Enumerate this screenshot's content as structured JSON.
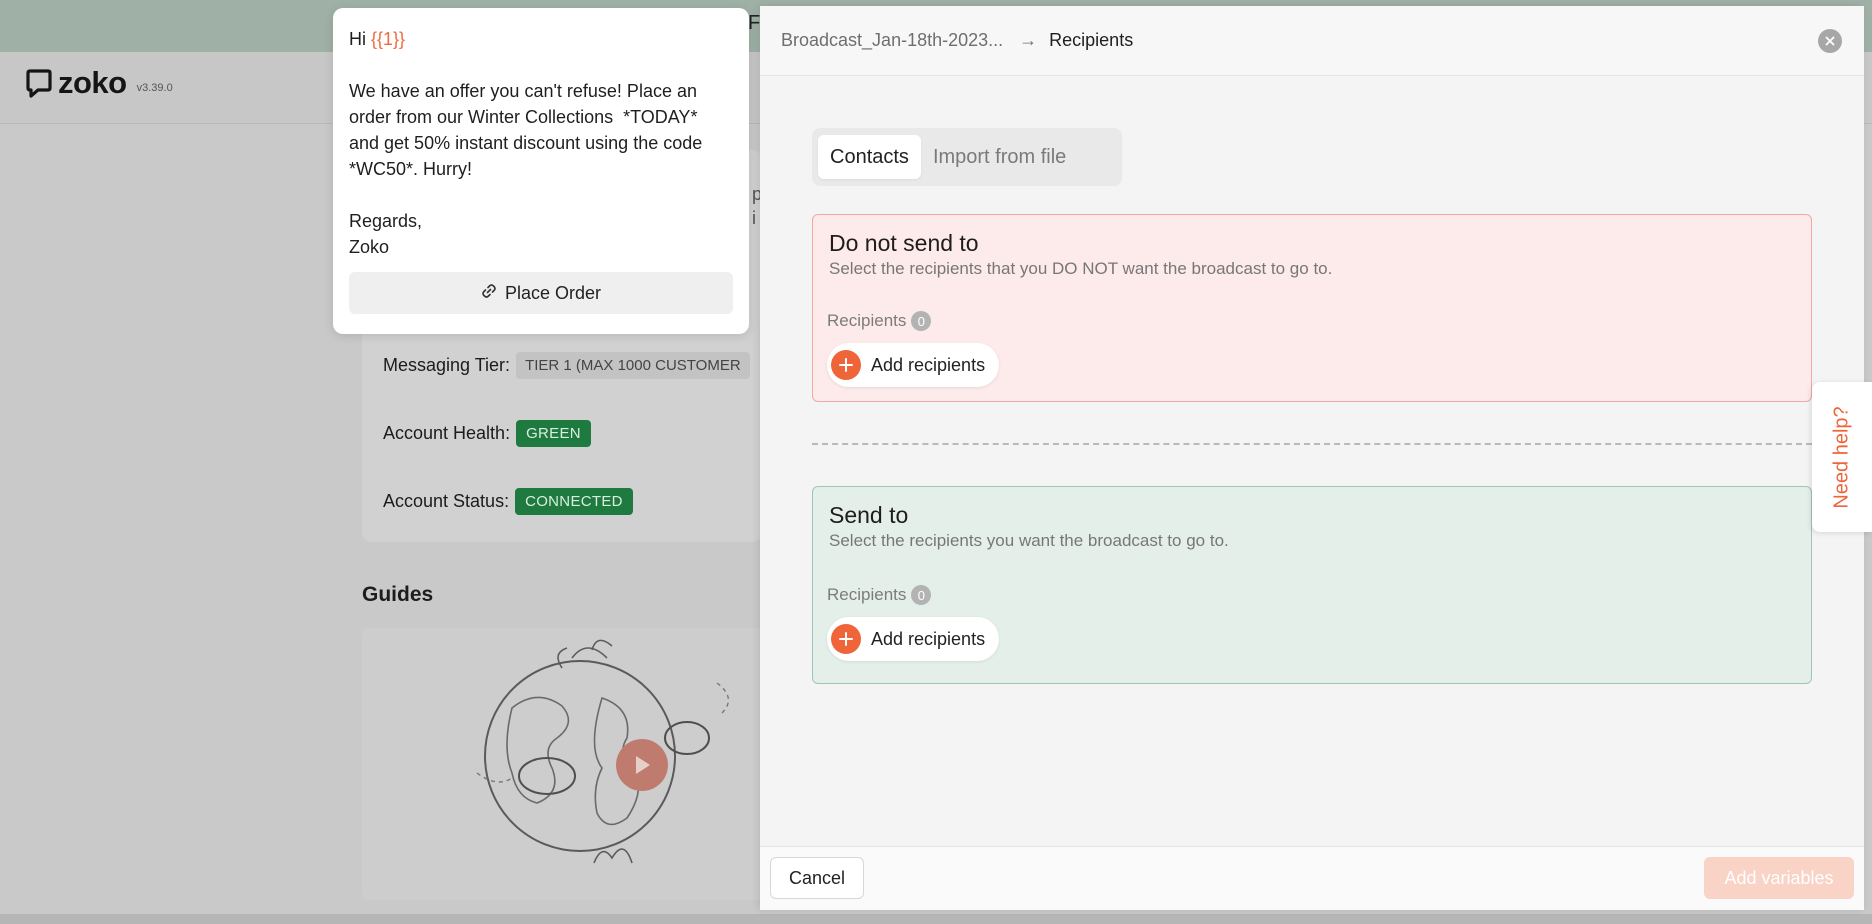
{
  "app": {
    "brand": "zoko",
    "version": "v3.39.0"
  },
  "background": {
    "messaging_tier_label": "Messaging Tier:",
    "messaging_tier_value": "TIER 1 (MAX 1000 CUSTOMER",
    "account_health_label": "Account Health:",
    "account_health_value": "GREEN",
    "account_status_label": "Account Status:",
    "account_status_value": "CONNECTED",
    "guides_title": "Guides",
    "frag_f": "F",
    "frag_p": "p",
    "frag_i": "i"
  },
  "preview": {
    "greeting": "Hi ",
    "variable": "{{1}}",
    "line1": "We have an offer you can't refuse! Place an",
    "line2": "order from our Winter Collections  *TODAY*",
    "line3": "and get 50% instant discount using the code",
    "line4": "*WC50*. Hurry!",
    "regards": "Regards,",
    "signature": "Zoko",
    "cta_label": "Place Order"
  },
  "modal": {
    "breadcrumb_broadcast": "Broadcast_Jan-18th-2023...",
    "breadcrumb_arrow": "→",
    "breadcrumb_current": "Recipients",
    "tabs": [
      {
        "label": "Contacts",
        "active": true
      },
      {
        "label": "Import from file",
        "active": false
      }
    ],
    "exclude": {
      "title": "Do not send to",
      "description": "Select the recipients that you DO NOT want the broadcast to go to.",
      "recipients_label": "Recipients",
      "count": "0",
      "add_label": "Add recipients"
    },
    "include": {
      "title": "Send to",
      "description": "Select the recipients you want the broadcast to go to.",
      "recipients_label": "Recipients",
      "count": "0",
      "add_label": "Add recipients"
    },
    "cancel_label": "Cancel",
    "add_variables_label": "Add variables"
  },
  "help": {
    "label": "Need help?"
  },
  "colors": {
    "accent": "#f0643a",
    "exclude_bg": "#fdeaea",
    "include_bg": "#e5efea",
    "status_green": "#1f7a40"
  },
  "icons": [
    "chat-logo-icon",
    "link-icon",
    "close-icon",
    "plus-icon",
    "play-icon"
  ]
}
